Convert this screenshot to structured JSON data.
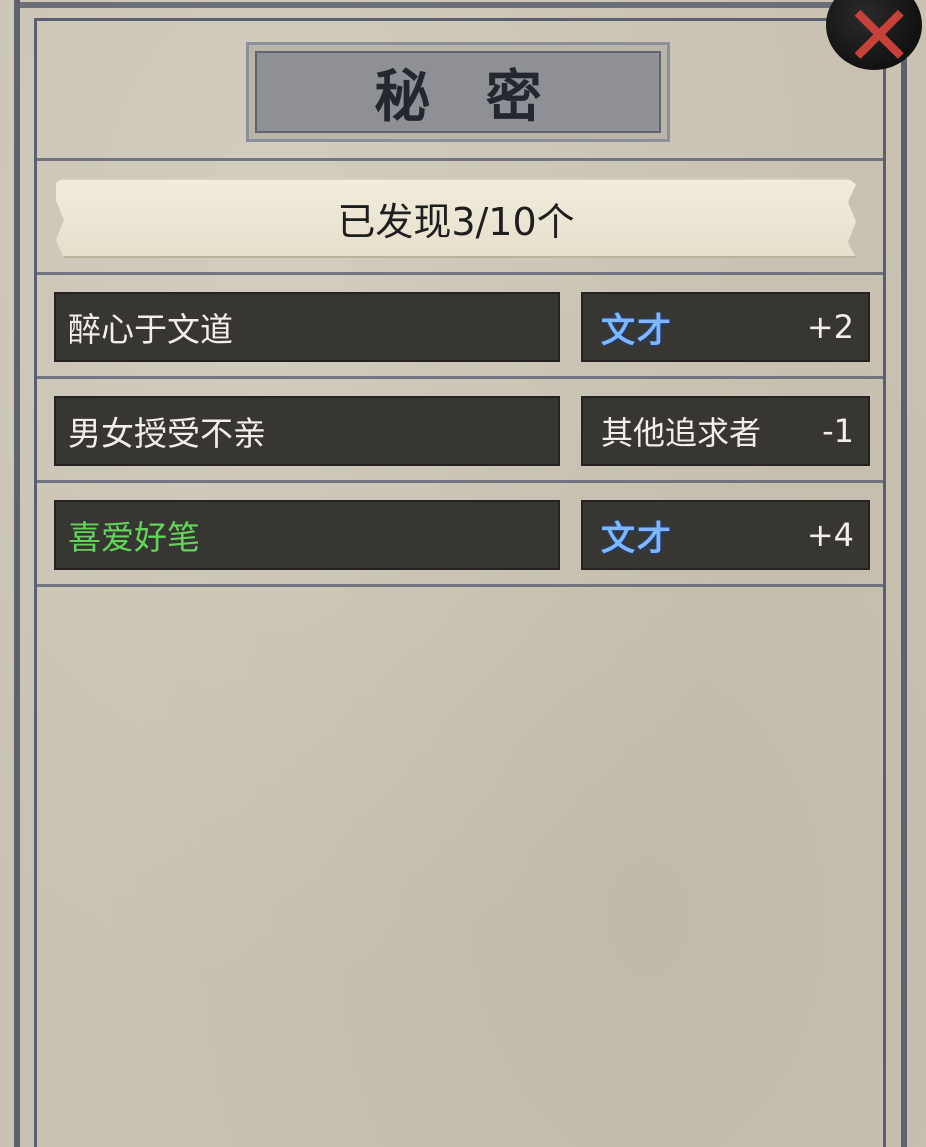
{
  "title": "秘 密",
  "progress": "已发现3/10个",
  "secrets": [
    {
      "name": "醉心于文道",
      "effect_label": "文才",
      "effect_is_stat": true,
      "effect_value": "+2",
      "highlight": false
    },
    {
      "name": "男女授受不亲",
      "effect_label": "其他追求者",
      "effect_is_stat": false,
      "effect_value": "-1",
      "highlight": false
    },
    {
      "name": "喜爱好笔",
      "effect_label": "文才",
      "effect_is_stat": true,
      "effect_value": "+4",
      "highlight": true
    }
  ],
  "colors": {
    "highlight_name": "#63d35c",
    "stat_label": "#7fb6ff",
    "close_mark": "#c8403a"
  },
  "icons": {
    "close": "close-icon"
  }
}
